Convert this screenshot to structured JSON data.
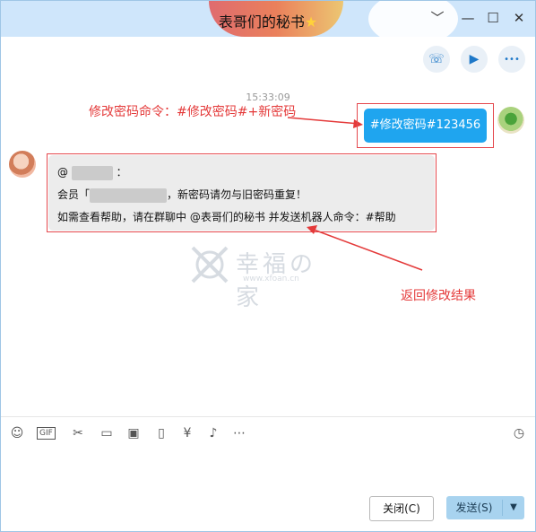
{
  "window": {
    "title": "表哥们的秘书",
    "title_star": "★",
    "minimize_icon": "﹀",
    "restore_icon": "—",
    "maximize_icon": "☐",
    "close_icon": "✕"
  },
  "actions": {
    "phone_icon": "☏",
    "video_icon": "▶",
    "more_icon": "•••"
  },
  "chat": {
    "timestamp": "15:33:09",
    "my_message": "#修改密码#123456",
    "bot_line1_prefix": "@",
    "bot_line1_suffix": "：",
    "bot_line2_prefix": "会员「",
    "bot_line2_suffix": "，新密码请勿与旧密码重复！",
    "bot_line3": "如需查看帮助，请在群聊中 @表哥们的秘书  并发送机器人命令：#帮助"
  },
  "annotations": {
    "top": "修改密码命令：#修改密码#+新密码",
    "bottom": "返回修改结果"
  },
  "watermark": {
    "text": "幸福の家",
    "url": "www.xfoan.cn"
  },
  "toolbar": {
    "emoji_icon": "☺",
    "gif_label": "GIF",
    "scissors_icon": "✂",
    "folder_icon": "▭",
    "image_icon": "▣",
    "shake_icon": "▯",
    "redpacket_icon": "¥",
    "music_icon": "♪",
    "more_icon": "⋯",
    "history_icon": "◷"
  },
  "buttons": {
    "close_label": "关闭(C)",
    "send_label": "发送(S)",
    "send_caret": "▼"
  },
  "colors": {
    "accent": "#1fa5ef",
    "annotation": "#e43a3a",
    "titlebar": "#cfe6fb"
  }
}
